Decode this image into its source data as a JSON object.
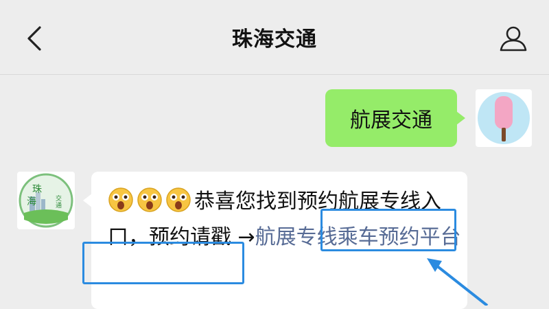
{
  "header": {
    "title": "珠海交通",
    "back_icon": "chevron-left-icon",
    "profile_icon": "person-icon"
  },
  "messages": [
    {
      "direction": "outgoing",
      "text": "航展交通"
    },
    {
      "direction": "incoming",
      "emojis": [
        "surprised-face-icon",
        "surprised-face-icon",
        "surprised-face-icon"
      ],
      "text_lead": "恭喜您找到预约航展专线入口，预约请戳 →",
      "link_text_1": "航展专线乘",
      "link_text_2": "车预约平台"
    }
  ],
  "colors": {
    "background": "#ededed",
    "outgoing_bubble": "#95ec69",
    "incoming_bubble": "#ffffff",
    "link": "#576b95",
    "highlight": "#2b8be0"
  }
}
